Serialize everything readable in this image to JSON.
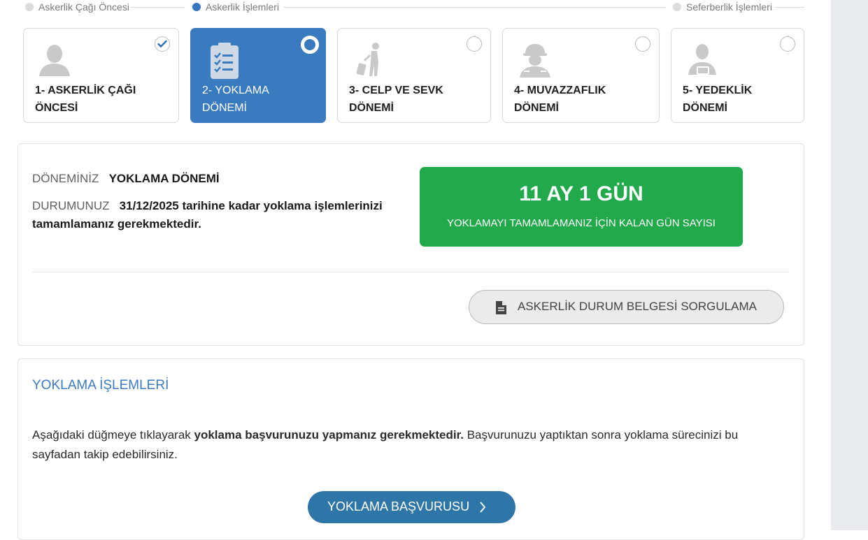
{
  "stepper": {
    "steps": [
      {
        "label": "Askerlik Çağı Öncesi",
        "state": "inactive"
      },
      {
        "label": "Askerlik İşlemleri",
        "state": "active"
      },
      {
        "label": "Seferberlik İşlemleri",
        "state": "inactive"
      }
    ]
  },
  "phases": [
    {
      "line1": "1- ASKERLİK ÇAĞI",
      "line2": "ÖNCESİ",
      "icon": "person-silhouette-icon",
      "status": "completed"
    },
    {
      "line1": "2- YOKLAMA",
      "line2": "DÖNEMİ",
      "icon": "clipboard-checklist-icon",
      "status": "current"
    },
    {
      "line1": "3- CELP VE SEVK",
      "line2": "DÖNEMİ",
      "icon": "traveler-with-luggage-icon",
      "status": "pending"
    },
    {
      "line1": "4- MUVAZZAFLIK",
      "line2": "DÖNEMİ",
      "icon": "soldier-helmet-icon",
      "status": "pending"
    },
    {
      "line1": "5- YEDEKLİK",
      "line2": "DÖNEMİ",
      "icon": "reservist-person-icon",
      "status": "pending"
    }
  ],
  "status": {
    "period_label": "DÖNEMİNİZ",
    "period_value": "YOKLAMA DÖNEMİ",
    "state_label": "DURUMUNUZ",
    "state_value_line1": "31/12/2025 tarihine kadar yoklama işlemlerinizi",
    "state_value_line2": "tamamlamanız gerekmektedir.",
    "countdown_value": "11 AY 1 GÜN",
    "countdown_caption": "YOKLAMAYI TAMAMLAMANIZ İÇİN KALAN GÜN SAYISI",
    "document_button": "ASKERLİK DURUM BELGESİ SORGULAMA"
  },
  "yoklama": {
    "title": "YOKLAMA İŞLEMLERİ",
    "text_before": "Aşağıdaki düğmeye tıklayarak ",
    "text_bold": "yoklama başvurunuzu yapmanız gerekmektedir.",
    "text_after": " Başvurunuzu yaptıktan sonra yoklama sürecinizi bu sayfadan takip edebilirsiniz.",
    "apply_button": "YOKLAMA BAŞVURUSU"
  },
  "colors": {
    "accent_blue": "#3a7bc0",
    "countdown_green": "#22a94b",
    "apply_button": "#2f76a8"
  }
}
